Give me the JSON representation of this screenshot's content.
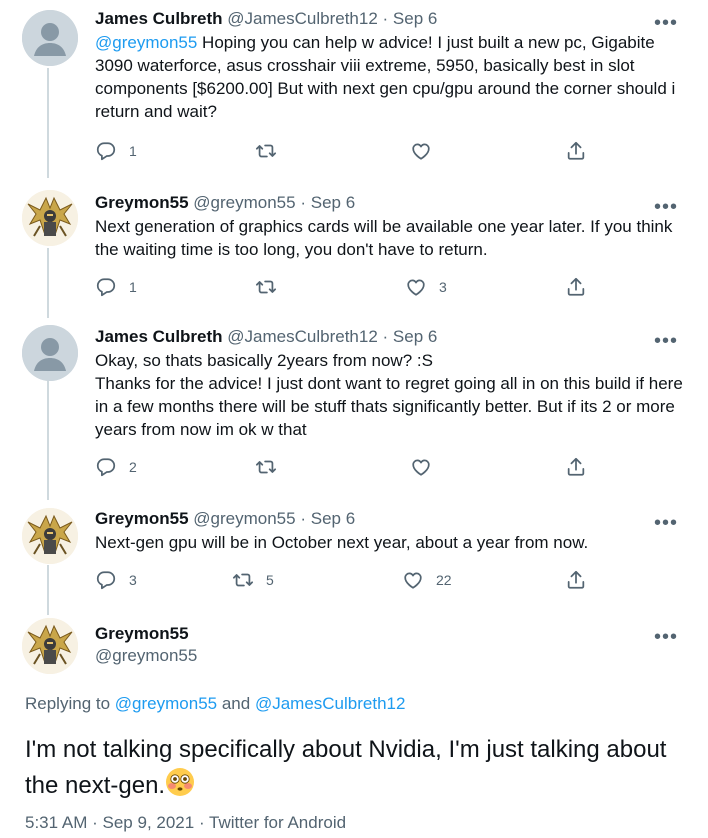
{
  "tweets": [
    {
      "name": "James Culbreth",
      "handle": "@JamesCulbreth12",
      "sep": "·",
      "date": "Sep 6",
      "avatar": "default-profile",
      "mention": "@greymon55",
      "text": " Hoping you can help w advice! I just built a new pc, Gigabite 3090 waterforce, asus crosshair viii extreme, 5950, basically best in slot components [$6200.00] But with next gen cpu/gpu around the corner should i return and wait?",
      "replies": "1",
      "retweets": "",
      "likes": ""
    },
    {
      "name": "Greymon55",
      "handle": "@greymon55",
      "sep": "·",
      "date": "Sep 6",
      "avatar": "armored-knight",
      "text": "Next generation of graphics cards will be available one year later. If you think the waiting time is too long, you don't have to return.",
      "replies": "1",
      "retweets": "",
      "likes": "3"
    },
    {
      "name": "James Culbreth",
      "handle": "@JamesCulbreth12",
      "sep": "·",
      "date": "Sep 6",
      "avatar": "default-profile",
      "line1": "Okay, so thats basically 2years from now? :S",
      "line2": "Thanks for the advice! I just dont want to regret going all in on this build if here in a few months there will be stuff thats significantly better. But if its 2 or more years from now im ok w that",
      "replies": "2",
      "retweets": "",
      "likes": ""
    },
    {
      "name": "Greymon55",
      "handle": "@greymon55",
      "sep": "·",
      "date": "Sep 6",
      "avatar": "armored-knight",
      "text": "Next-gen gpu will be in October next year, about a year from now.",
      "replies": "3",
      "retweets": "5",
      "likes": "22"
    }
  ],
  "main_tweet": {
    "name": "Greymon55",
    "handle": "@greymon55",
    "avatar": "armored-knight",
    "replying_label": "Replying to",
    "replying_user1": "@greymon55",
    "replying_and": "and",
    "replying_user2": "@JamesCulbreth12",
    "text": "I'm not talking specifically about Nvidia, I'm just talking about the next-gen.",
    "emoji": "flushed-face",
    "time": "5:31 AM",
    "sep": "·",
    "date": "Sep 9, 2021",
    "source": "Twitter for Android"
  },
  "more_glyph": "•••",
  "colors": {
    "link": "#1d9bf0",
    "muted": "#536471",
    "thread": "#cfd9de"
  }
}
